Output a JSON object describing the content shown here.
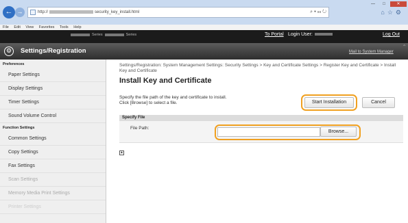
{
  "browser": {
    "url_prefix": "http://",
    "url_suffix": "security_key_install.html",
    "search_icons": "⌕ ▾ ☷ ↻",
    "menu": [
      "File",
      "Edit",
      "View",
      "Favorites",
      "Tools",
      "Help"
    ]
  },
  "header": {
    "portal": "To Portal",
    "login_label": "Login User:",
    "logout": "Log Out",
    "app_title": "Settings/Registration",
    "mail": "Mail to System Manager",
    "product_suffix": "Series",
    "product_suffix2": "Series"
  },
  "sidebar": {
    "section_preferences": "Preferences",
    "preferences": [
      "Paper Settings",
      "Display Settings",
      "Timer Settings",
      "Sound Volume Control"
    ],
    "section_function": "Function Settings",
    "function": [
      "Common Settings",
      "Copy Settings",
      "Fax Settings",
      "Scan Settings",
      "Memory Media Print Settings",
      "Printer Settings"
    ]
  },
  "main": {
    "breadcrumb": "Settings/Registration: System Management Settings: Security Settings > Key and Certificate Settings > Register Key and Certificate > Install Key and Certificate",
    "title": "Install Key and Certificate",
    "instruction_1": "Specify the file path of the key and certificate to install.",
    "instruction_2": "Click [Browse] to select a file.",
    "start_button": "Start Installation",
    "cancel_button": "Cancel",
    "section_title": "Specify File",
    "file_path_label": "File Path:",
    "browse_button": "Browse..."
  }
}
